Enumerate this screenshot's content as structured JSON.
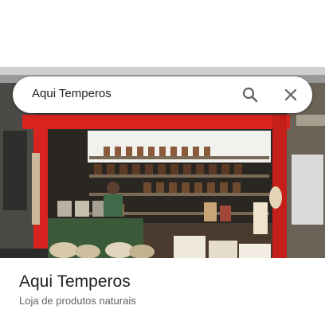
{
  "search": {
    "query": "Aqui Temperos"
  },
  "place": {
    "name": "Aqui Temperos",
    "category": "Loja de produtos naturais"
  },
  "colors": {
    "stall_frame": "#d8231e",
    "text_primary": "#202124",
    "text_secondary": "#5f6368",
    "icon": "#5f6368"
  },
  "icons": {
    "search": "search-icon",
    "close": "close-icon"
  }
}
